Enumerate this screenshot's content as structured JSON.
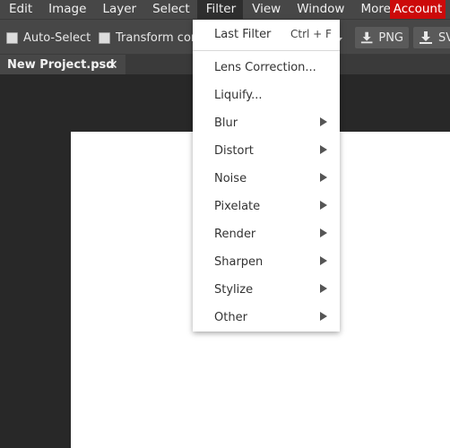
{
  "menubar": {
    "items": [
      {
        "label": "Edit"
      },
      {
        "label": "Image"
      },
      {
        "label": "Layer"
      },
      {
        "label": "Select"
      },
      {
        "label": "Filter"
      },
      {
        "label": "View"
      },
      {
        "label": "Window"
      },
      {
        "label": "More"
      }
    ],
    "account": "Account"
  },
  "toolbar": {
    "auto_select": "Auto-Select",
    "transform": "Transform con",
    "png": "PNG",
    "svg": "SV"
  },
  "tab": {
    "title": "New Project.psd",
    "close": "✕"
  },
  "filter_menu": {
    "last_filter": {
      "label": "Last Filter",
      "shortcut": "Ctrl + F"
    },
    "items": [
      {
        "label": "Lens Correction..."
      },
      {
        "label": "Liquify..."
      },
      {
        "label": "Blur"
      },
      {
        "label": "Distort"
      },
      {
        "label": "Noise"
      },
      {
        "label": "Pixelate"
      },
      {
        "label": "Render"
      },
      {
        "label": "Sharpen"
      },
      {
        "label": "Stylize"
      },
      {
        "label": "Other"
      }
    ]
  },
  "colors": {
    "account_bg": "#cc0a0a",
    "menubar_bg": "#474747",
    "workspace_bg": "#282828"
  }
}
